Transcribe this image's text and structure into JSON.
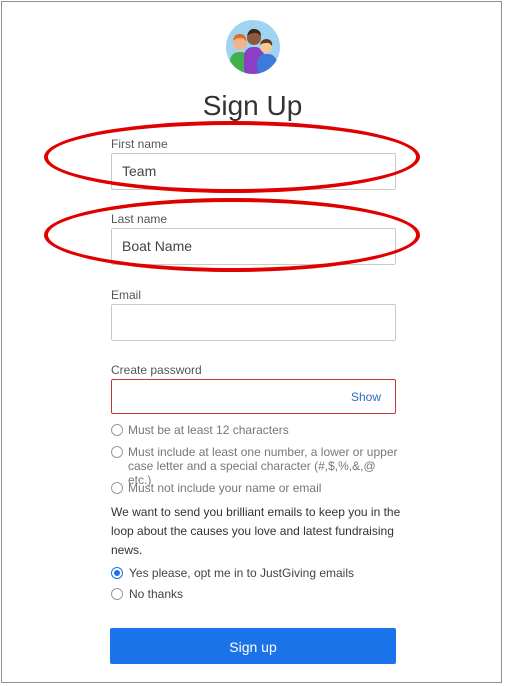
{
  "page": {
    "title": "Sign Up"
  },
  "logo": {
    "icon": "people-group-icon"
  },
  "form": {
    "first_name": {
      "label": "First name",
      "value": "Team"
    },
    "last_name": {
      "label": "Last name",
      "value": "Boat Name"
    },
    "email": {
      "label": "Email",
      "value": ""
    },
    "password": {
      "label": "Create password",
      "value": "",
      "show_label": "Show"
    },
    "password_rules": [
      "Must be at least 12 characters",
      "Must include at least one number, a lower or upper case letter and a special character (#,$,%,&,@ etc.)",
      "Must not include your name or email"
    ],
    "marketing_note": "We want to send you brilliant emails to keep you in the loop about the causes you love and latest fundraising news.",
    "opt_in_options": [
      {
        "label": "Yes please, opt me in to JustGiving emails",
        "selected": true
      },
      {
        "label": "No thanks",
        "selected": false
      }
    ],
    "submit_label": "Sign up"
  },
  "colors": {
    "accent": "#1a73e8",
    "error_border": "#c23934",
    "annotation": "#e00000"
  }
}
